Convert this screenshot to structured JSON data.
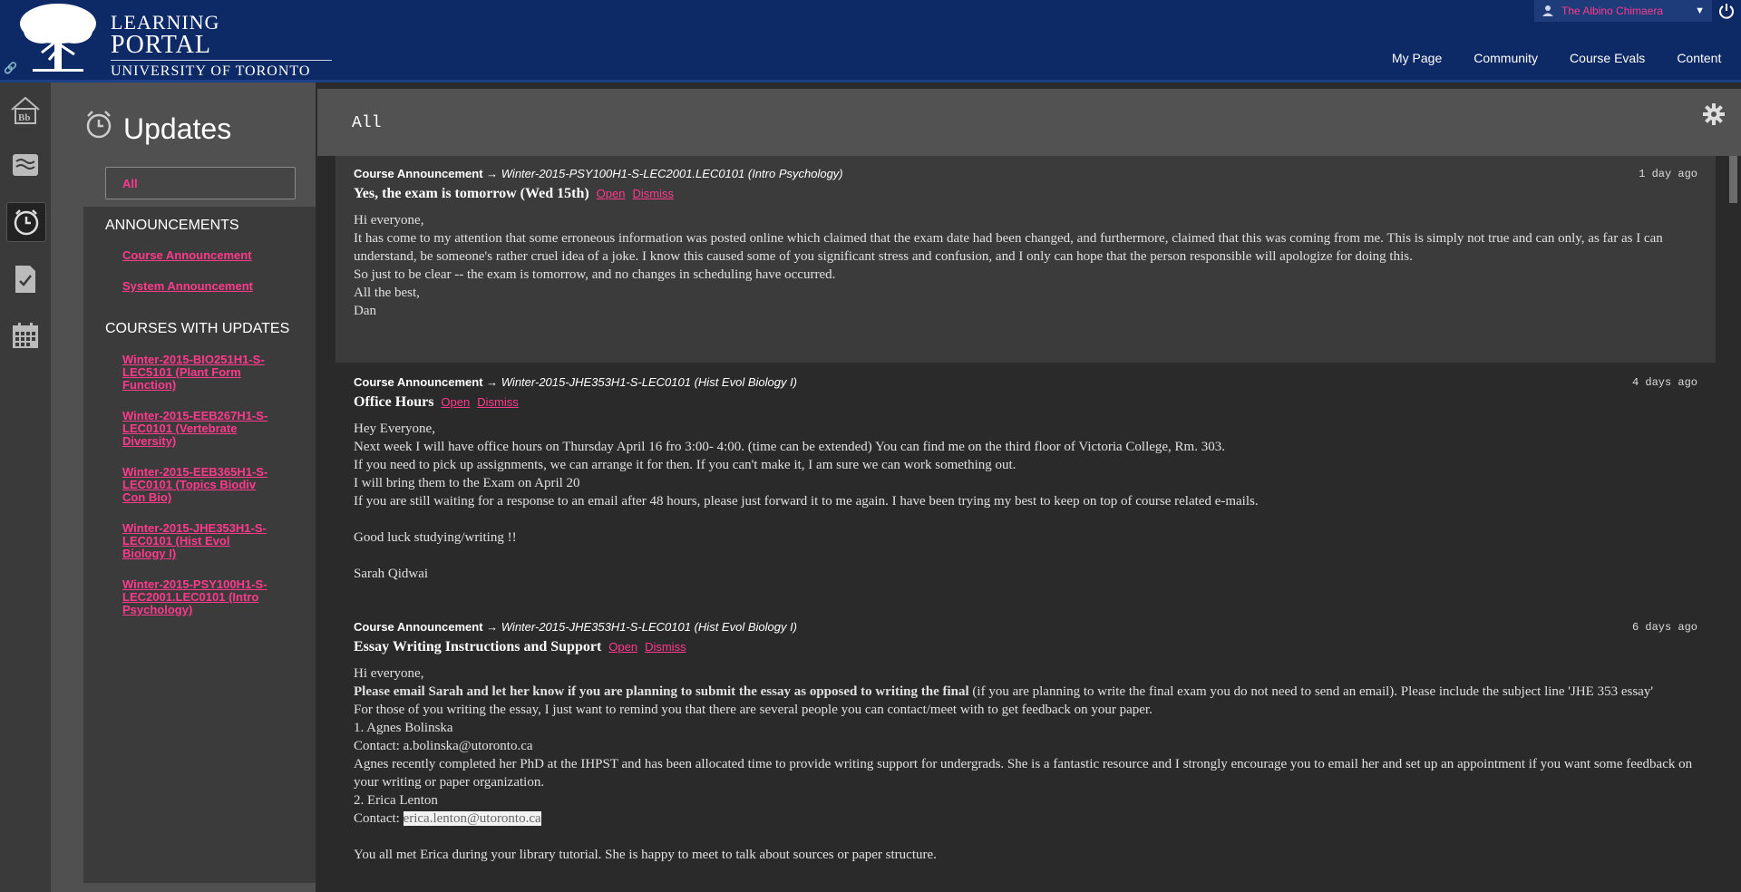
{
  "header": {
    "logo": {
      "line1": "LEARNING",
      "line2": "PORTAL",
      "line3": "UNIVERSITY OF TORONTO"
    },
    "user_name": "The Albino Chimaera",
    "nav": [
      "My Page",
      "Community",
      "Course Evals",
      "Content"
    ]
  },
  "rail": {
    "items": [
      "home-icon",
      "stream-icon",
      "updates-icon",
      "grades-icon",
      "calendar-icon"
    ]
  },
  "sidebar": {
    "title": "Updates",
    "all": "All",
    "announcements_head": "ANNOUNCEMENTS",
    "announcements": [
      "Course Announcement",
      "System Announcement"
    ],
    "courses_head": "COURSES WITH UPDATES",
    "courses": [
      [
        "Winter-2015-BIO251H1-S-",
        "LEC5101 (Plant Form",
        "Function)"
      ],
      [
        "Winter-2015-EEB267H1-S-",
        "LEC0101 (Vertebrate",
        "Diversity)"
      ],
      [
        "Winter-2015-EEB365H1-S-",
        "LEC0101 (Topics Biodiv",
        "Con Bio)"
      ],
      [
        "Winter-2015-JHE353H1-S-",
        "LEC0101 (Hist Evol",
        "Biology I)"
      ],
      [
        "Winter-2015-PSY100H1-S-",
        "LEC2001.LEC0101 (Intro",
        "Psychology)"
      ]
    ]
  },
  "main": {
    "title": "All",
    "open_label": "Open",
    "dismiss_label": "Dismiss",
    "items": [
      {
        "type": "Course Announcement →",
        "course": "Winter-2015-PSY100H1-S-LEC2001.LEC0101 (Intro Psychology)",
        "when": "1 day ago",
        "subject": "Yes, the exam is tomorrow (Wed 15th)",
        "lines": [
          "Hi everyone,",
          "It has come to my attention that some erroneous information was posted online which claimed that the exam date had been changed, and furthermore, claimed that this was coming from me.  This is simply not true and can only, as far as I can understand, be someone's rather cruel idea of a joke. I know this caused some of you significant stress and confusion, and I only can hope that the person responsible will apologize for doing this.",
          "So just to be clear -- the exam is tomorrow, and no changes in scheduling have occurred.",
          "All the best,",
          "Dan"
        ]
      },
      {
        "type": "Course Announcement →",
        "course": "Winter-2015-JHE353H1-S-LEC0101 (Hist Evol Biology I)",
        "when": "4 days ago",
        "subject": "Office Hours",
        "lines": [
          "Hey Everyone,",
          "Next week I will have office hours on Thursday April 16 fro 3:00- 4:00. (time can be extended) You can find me on the third floor of Victoria College, Rm. 303.",
          "If you need to pick up assignments, we can arrange it for then. If you can't make it, I am sure we can work something out.",
          "I will bring them to the Exam on April 20",
          "If you are still waiting for a response to an email after 48 hours, please just forward it to me again. I have been trying my best to keep on top of course related e-mails.",
          "",
          "Good luck studying/writing !!",
          "",
          "Sarah Qidwai"
        ]
      },
      {
        "type": "Course Announcement →",
        "course": "Winter-2015-JHE353H1-S-LEC0101 (Hist Evol Biology I)",
        "when": "6 days ago",
        "subject": "Essay Writing Instructions and Support",
        "line1": "Hi everyone,",
        "bold": "Please email Sarah and let her know if you are planning to submit the essay as opposed to writing the final",
        "after_bold": " (if you are planning to write the final exam you do not need to send an email). Please include the subject line 'JHE 353 essay'",
        "lines": [
          "For those of you writing the essay, I just want to remind you that there are several people you can contact/meet with to get feedback on your paper.",
          "1. Agnes Bolinska",
          "Contact: a.bolinska@utoronto.ca",
          "Agnes recently completed her PhD at the IHPST and has been allocated time to provide writing support for undergrads. She is a fantastic resource and I strongly encourage you to email her and set up an appointment if you want some feedback on your writing or paper organization.",
          "2. Erica Lenton"
        ],
        "contact_label": "Contact: ",
        "contact_email": "erica.lenton@utoronto.ca",
        "last_line": "You all met Erica during your library tutorial. She is happy to meet to talk about sources or paper structure."
      }
    ]
  }
}
